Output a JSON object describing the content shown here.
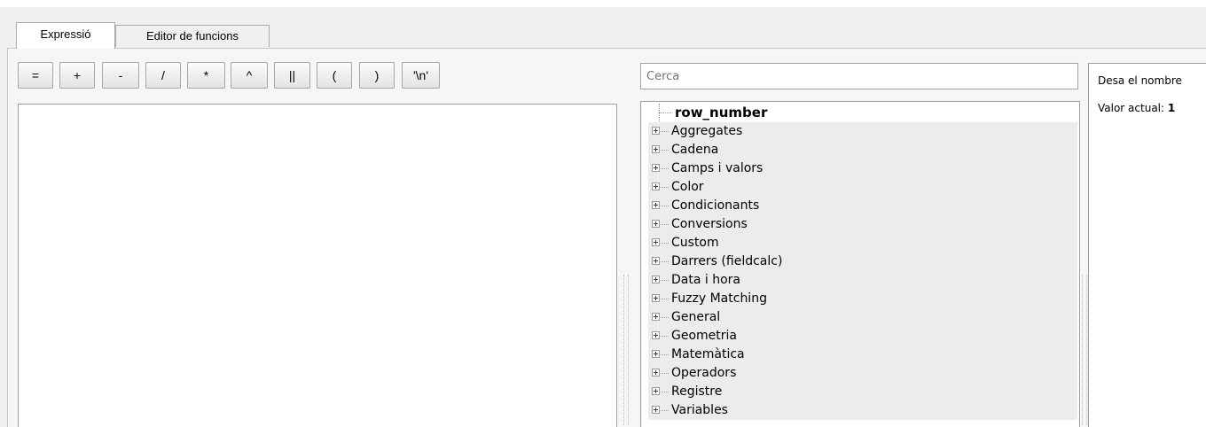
{
  "tabs": [
    {
      "label": "Expressió",
      "active": true
    },
    {
      "label": "Editor de funcions",
      "active": false
    }
  ],
  "operators": [
    "=",
    "+",
    "-",
    "/",
    "*",
    "^",
    "||",
    "(",
    ")",
    "'\\n'"
  ],
  "search": {
    "placeholder": "Cerca"
  },
  "tree": {
    "selected": "row_number",
    "groups": [
      "Aggregates",
      "Cadena",
      "Camps i valors",
      "Color",
      "Condicionants",
      "Conversions",
      "Custom",
      "Darrers (fieldcalc)",
      "Data i hora",
      "Fuzzy Matching",
      "General",
      "Geometria",
      "Matemàtica",
      "Operadors",
      "Registre",
      "Variables"
    ]
  },
  "help": {
    "description": "Desa el nombre",
    "current_label": "Valor actual:",
    "current_value": "1"
  }
}
